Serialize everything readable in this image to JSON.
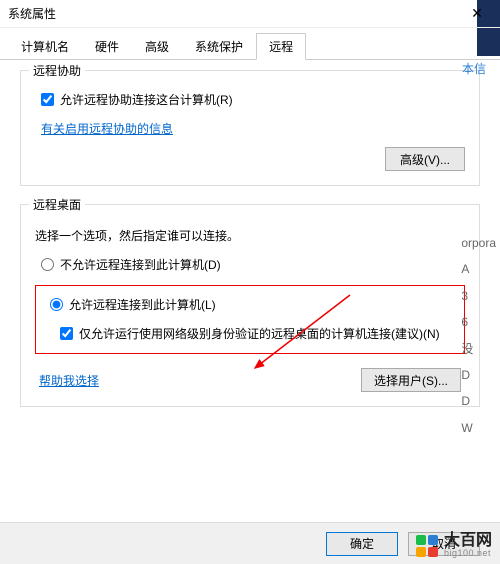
{
  "window": {
    "title": "系统属性",
    "close_icon": "✕"
  },
  "tabs": {
    "items": [
      {
        "label": "计算机名"
      },
      {
        "label": "硬件"
      },
      {
        "label": "高级"
      },
      {
        "label": "系统保护"
      },
      {
        "label": "远程"
      }
    ],
    "active_index": 4
  },
  "remote_assist": {
    "legend": "远程协助",
    "checkbox_label": "允许远程协助连接这台计算机(R)",
    "checkbox_checked": true,
    "help_link": "有关启用远程协助的信息",
    "advanced_btn": "高级(V)..."
  },
  "remote_desktop": {
    "legend": "远程桌面",
    "desc": "选择一个选项，然后指定谁可以连接。",
    "radio1_label": "不允许远程连接到此计算机(D)",
    "radio2_label": "允许远程连接到此计算机(L)",
    "radio_selected": 2,
    "sub_check_label": "仅允许运行使用网络级别身份验证的远程桌面的计算机连接(建议)(N)",
    "sub_check_checked": true,
    "help_link": "帮助我选择",
    "select_users_btn": "选择用户(S)..."
  },
  "buttons": {
    "ok": "确定",
    "cancel": "取消"
  },
  "side": {
    "partial1": "本信",
    "items": [
      "orpora",
      "A",
      "3",
      "6",
      "没",
      "",
      "D",
      "D",
      "",
      "W"
    ]
  },
  "watermark": {
    "cn": "大百网",
    "en": "big100.net"
  }
}
